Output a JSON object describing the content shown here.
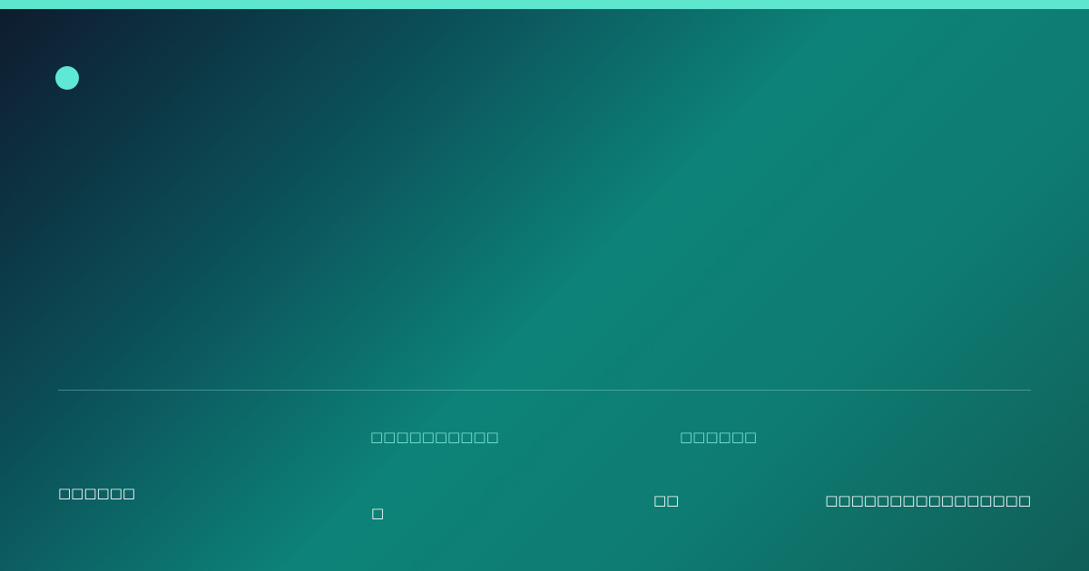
{
  "colors": {
    "accent": "#5ee6cf",
    "background_start": "#0e1a2e",
    "background_mid": "#0d8378",
    "background_end": "#105e58"
  },
  "footer": {
    "left_text": "□□□□□□",
    "center_heading": "□□□□□□□□□□",
    "center_sub": "□",
    "right_heading": "□□□□□□",
    "right_small": "□□",
    "far_right_text": "□□□□□□□□□□□□□□□□"
  }
}
